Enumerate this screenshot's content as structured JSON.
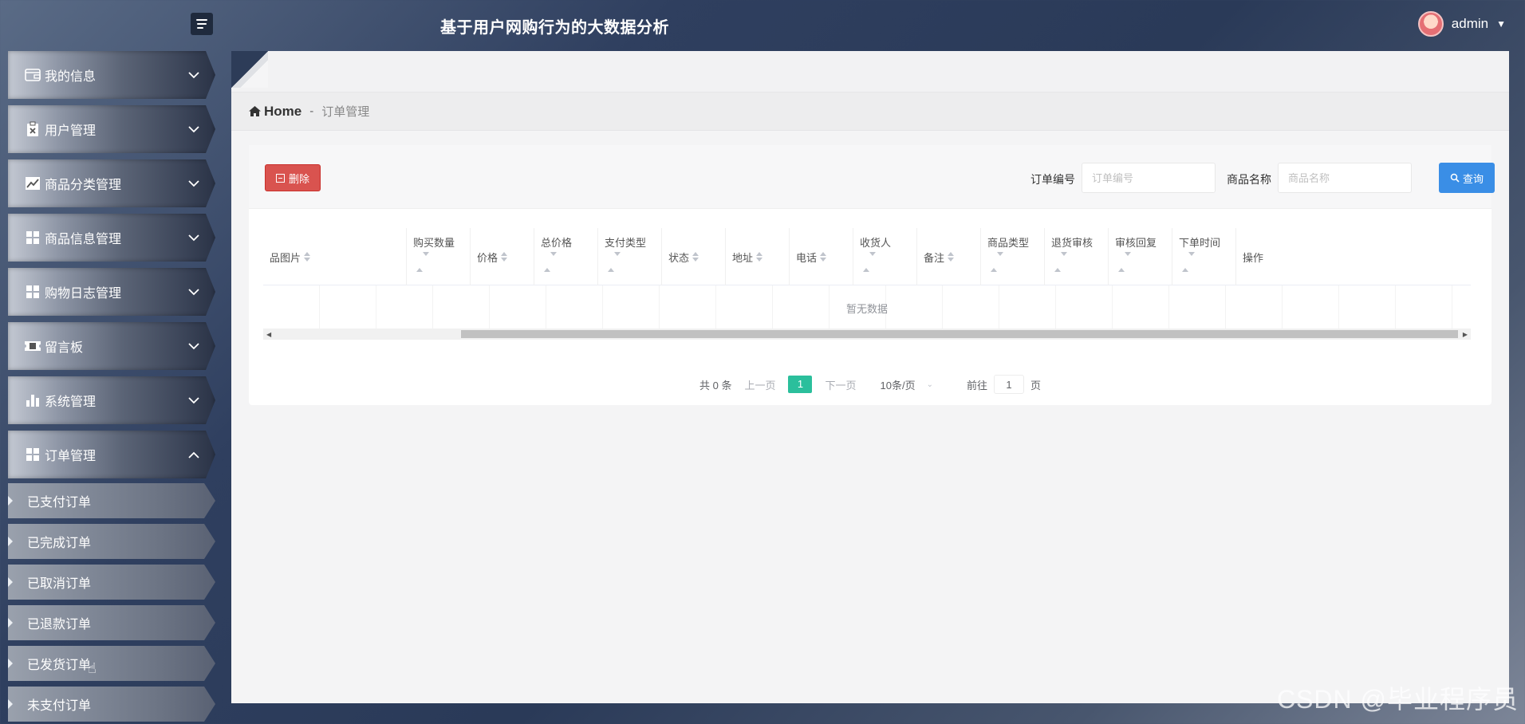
{
  "app": {
    "title": "基于用户网购行为的大数据分析"
  },
  "user": {
    "name": "admin"
  },
  "sidebar": {
    "items": [
      {
        "label": "我的信息",
        "icon": "wallet-icon"
      },
      {
        "label": "用户管理",
        "icon": "clipboard-icon"
      },
      {
        "label": "商品分类管理",
        "icon": "line-chart-icon"
      },
      {
        "label": "商品信息管理",
        "icon": "grid-icon"
      },
      {
        "label": "购物日志管理",
        "icon": "grid-icon"
      },
      {
        "label": "留言板",
        "icon": "ticket-icon"
      },
      {
        "label": "系统管理",
        "icon": "bar-chart-icon"
      },
      {
        "label": "订单管理",
        "icon": "grid-icon",
        "expanded": true
      }
    ],
    "submenu": [
      {
        "label": "已支付订单"
      },
      {
        "label": "已完成订单"
      },
      {
        "label": "已取消订单"
      },
      {
        "label": "已退款订单"
      },
      {
        "label": "已发货订单"
      },
      {
        "label": "未支付订单"
      }
    ]
  },
  "breadcrumb": {
    "home": "Home",
    "sep": "-",
    "current": "订单管理"
  },
  "toolbar": {
    "delete_label": "删除",
    "order_no_label": "订单编号",
    "order_no_placeholder": "订单编号",
    "product_name_label": "商品名称",
    "product_name_placeholder": "商品名称",
    "search_label": "查询"
  },
  "table": {
    "columns": [
      {
        "label": "品图片"
      },
      {
        "label": "购买数量"
      },
      {
        "label": "价格"
      },
      {
        "label": "总价格"
      },
      {
        "label": "支付类型"
      },
      {
        "label": "状态"
      },
      {
        "label": "地址"
      },
      {
        "label": "电话"
      },
      {
        "label": "收货人"
      },
      {
        "label": "备注"
      },
      {
        "label": "商品类型"
      },
      {
        "label": "退货审核"
      },
      {
        "label": "审核回复"
      },
      {
        "label": "下单时间"
      },
      {
        "label": "操作"
      }
    ],
    "empty_text": "暂无数据"
  },
  "pager": {
    "total": "共 0 条",
    "prev": "上一页",
    "current_page": "1",
    "next": "下一页",
    "page_size": "10条/页",
    "goto_prefix": "前往",
    "goto_value": "1",
    "goto_suffix": "页"
  },
  "watermark": "CSDN @毕业程序员",
  "colors": {
    "delete": "#d9534f",
    "search": "#3a8ee6",
    "active_page": "#2bbf9c"
  }
}
